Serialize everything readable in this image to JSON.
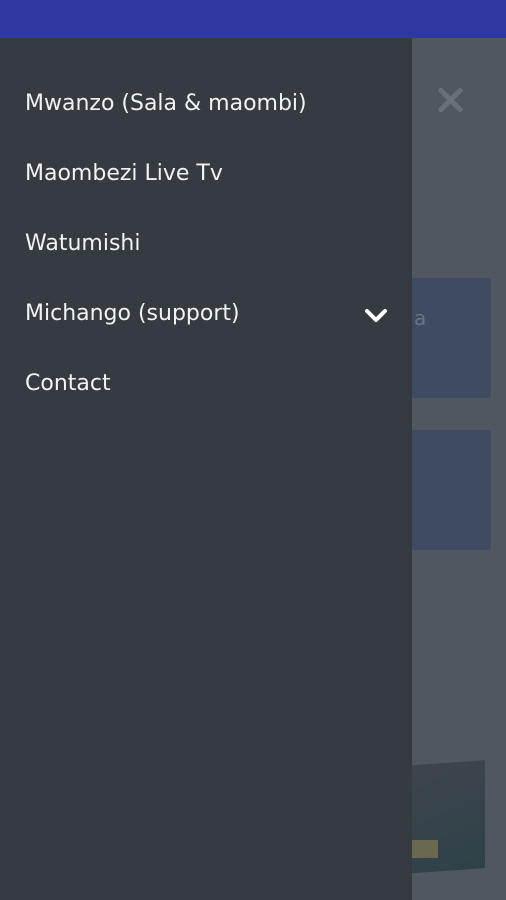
{
  "menu": {
    "items": [
      {
        "label": "Mwanzo (Sala & maombi)"
      },
      {
        "label": "Maombezi Live Tv"
      },
      {
        "label": "Watumishi"
      },
      {
        "label": "Michango (support)",
        "icon": "chevron-down-icon"
      },
      {
        "label": "Contact"
      }
    ]
  },
  "background": {
    "close_icon": "close-icon",
    "card_partial_text": "a"
  },
  "colors": {
    "status_bar": "#2f3aa0",
    "drawer_bg": "#353b40",
    "menu_text": "#f2f2f2",
    "overlay_bg": "#505760"
  }
}
